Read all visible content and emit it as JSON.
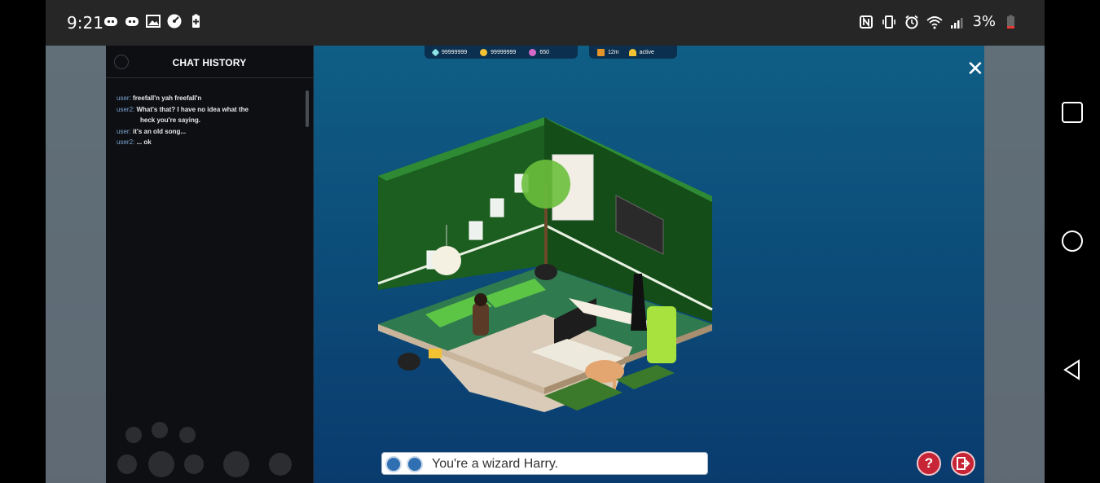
{
  "status_bar": {
    "time": "9:21",
    "battery_percent": "3%",
    "left_icons": [
      "discord-icon",
      "discord-icon",
      "image-icon",
      "speedometer-icon",
      "battery-saver-icon"
    ],
    "right_icons": [
      "nfc-icon",
      "vibrate-icon",
      "alarm-icon",
      "wifi-icon",
      "signal-icon",
      "battery-icon"
    ]
  },
  "chat_history": {
    "title": "CHAT HISTORY",
    "messages": [
      {
        "user": "user:",
        "text": "freefall'n yah freefall'n"
      },
      {
        "user": "user2:",
        "text": "What's that? I have no idea what the",
        "continuation": "heck you're saying."
      },
      {
        "user": "user:",
        "text": "it's an old song..."
      },
      {
        "user": "user2:",
        "text": "... ok"
      }
    ]
  },
  "currency": {
    "diamonds": "99999999",
    "credits": "99999999",
    "duckets": "650",
    "club_time": "12m",
    "status": "active"
  },
  "chat_input": {
    "value": "You're a wizard Harry."
  },
  "buttons": {
    "close": "✕",
    "help": "?"
  },
  "colors": {
    "wall_green": "#1b5e1f",
    "floor_green": "#2e7d4f",
    "help_red": "#c72435",
    "sea_blue": "#0c4a78"
  }
}
